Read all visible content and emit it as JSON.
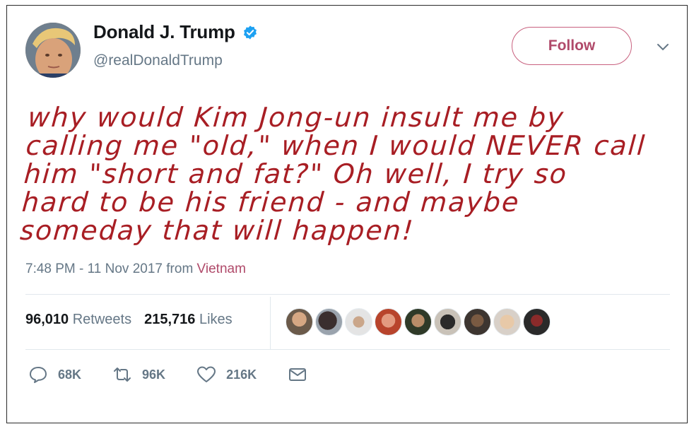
{
  "user": {
    "display_name": "Donald J. Trump",
    "handle": "@realDonaldTrump",
    "verified": true,
    "follow_label": "Follow"
  },
  "tweet": {
    "text_lines": [
      "why would Kim Jong-un insult me by",
      "calling me \"old,\" when I would NEVER call",
      "him \"short and fat?\" Oh well, I try so",
      "hard to be his friend - and maybe",
      "someday that will happen!"
    ],
    "time": "7:48 PM - 11 Nov 2017",
    "from_label": "from",
    "location": "Vietnam",
    "text_color": "#a81e24"
  },
  "stats": {
    "retweets_count": "96,010",
    "retweets_label": "Retweets",
    "likes_count": "215,716",
    "likes_label": "Likes"
  },
  "likers": [
    "liker-avatar",
    "liker-avatar",
    "liker-avatar",
    "liker-avatar",
    "liker-avatar",
    "liker-avatar",
    "liker-avatar",
    "liker-avatar",
    "liker-avatar"
  ],
  "actions": {
    "reply_count": "68K",
    "retweet_count": "96K",
    "like_count": "216K"
  },
  "colors": {
    "accent": "#b04a6a",
    "verified": "#1da1f2",
    "muted": "#657786"
  }
}
